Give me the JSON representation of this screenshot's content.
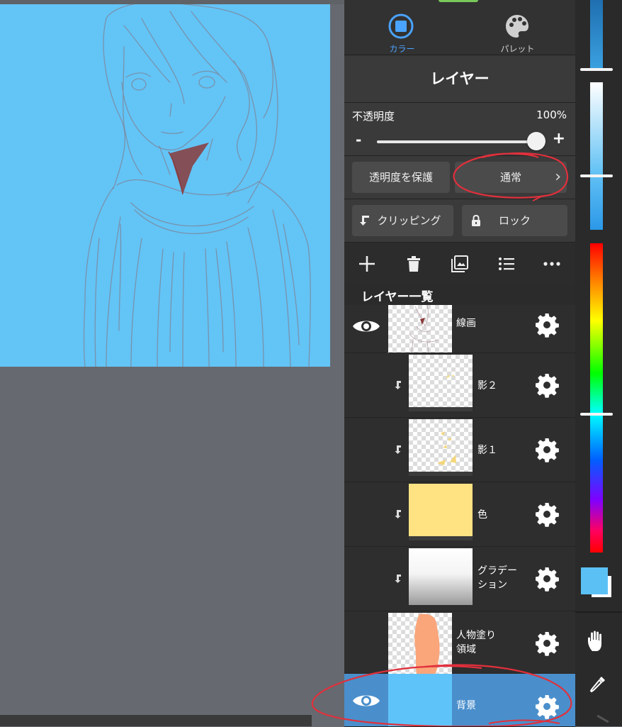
{
  "tabs": [
    {
      "label": "カラー",
      "icon": "color-circle-icon",
      "active": true
    },
    {
      "label": "パレット",
      "icon": "palette-icon",
      "active": false
    }
  ],
  "panel": {
    "title": "レイヤー",
    "opacity": {
      "label": "不透明度",
      "value_text": "100%",
      "value": 1.0,
      "minus": "-",
      "plus": "+"
    },
    "buttons": {
      "protect_alpha": "透明度を保護",
      "blend_mode": "通常",
      "clipping": "クリッピング",
      "lock": "ロック"
    },
    "toolbar": [
      "add-layer-icon",
      "trash-icon",
      "gallery-icon",
      "list-icon",
      "more-icon"
    ],
    "list_title": "レイヤー一覧"
  },
  "layers": [
    {
      "name": "線画",
      "visible": true,
      "clipped": false,
      "selected": false
    },
    {
      "name": "影２",
      "visible": false,
      "clipped": true,
      "selected": false
    },
    {
      "name": "影１",
      "visible": false,
      "clipped": true,
      "selected": false
    },
    {
      "name": "色",
      "visible": false,
      "clipped": true,
      "selected": false
    },
    {
      "name_line1": "グラデー",
      "name_line2": "ション",
      "visible": false,
      "clipped": true,
      "selected": false
    },
    {
      "name_line1": "人物塗り",
      "name_line2": "領域",
      "visible": false,
      "clipped": false,
      "selected": false
    },
    {
      "name": "背景",
      "visible": true,
      "clipped": false,
      "selected": true
    }
  ],
  "colors": {
    "canvas_fill": "#63c4f6",
    "current_color": "#5bc1f5",
    "panel_bg": "#2b2b2b",
    "accent": "#4aa3ff",
    "selected_layer": "#4a8fcc",
    "annotation": "#e0303c"
  }
}
